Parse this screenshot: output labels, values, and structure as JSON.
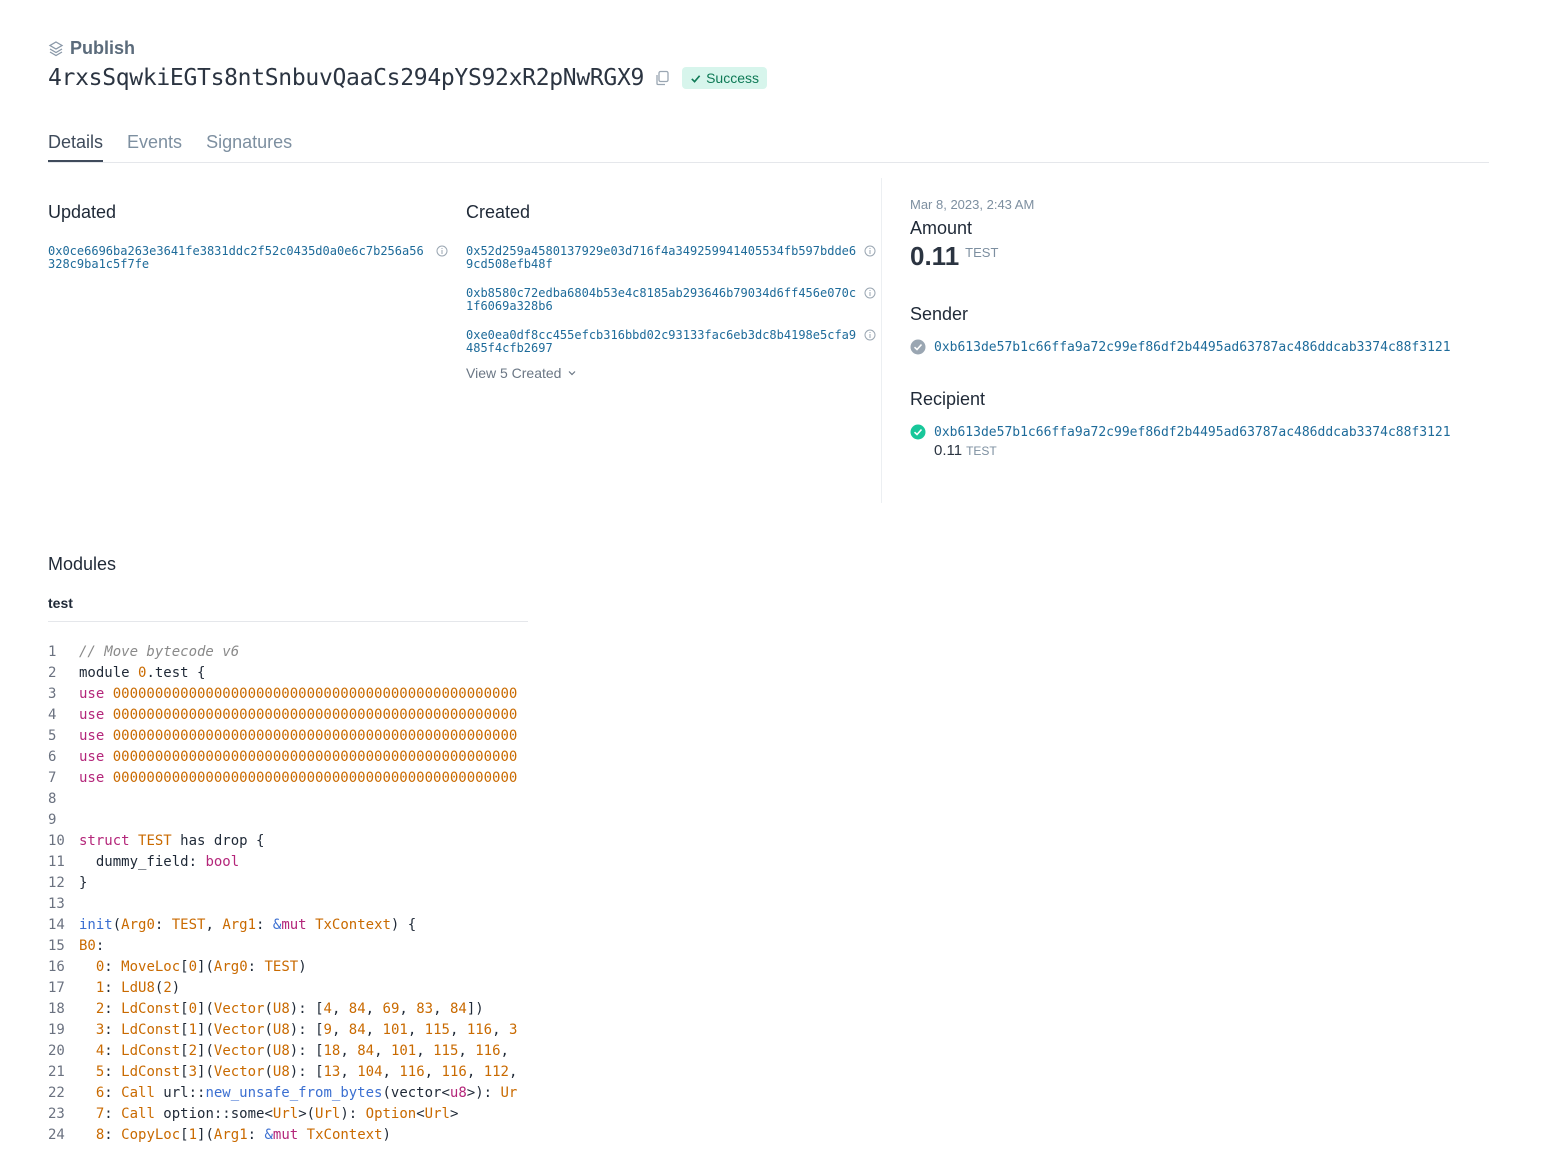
{
  "header": {
    "kind_label": "Publish",
    "digest": "4rxsSqwkiEGTs8ntSnbuvQaaCs294pYS92xR2pNwRGX9",
    "status": "Success"
  },
  "tabs": [
    {
      "label": "Details"
    },
    {
      "label": "Events"
    },
    {
      "label": "Signatures"
    }
  ],
  "updated": {
    "title": "Updated",
    "objects": [
      "0x0ce6696ba263e3641fe3831ddc2f52c0435d0a0e6c7b256a56328c9ba1c5f7fe"
    ]
  },
  "created": {
    "title": "Created",
    "objects": [
      "0x52d259a4580137929e03d716f4a349259941405534fb597bdde69cd508efb48f",
      "0xb8580c72edba6804b53e4c8185ab293646b79034d6ff456e070c1f6069a328b6",
      "0xe0ea0df8cc455efcb316bbd02c93133fac6eb3dc8b4198e5cfa9485f4cfb2697"
    ],
    "view_more": "View 5 Created"
  },
  "summary": {
    "timestamp": "Mar 8, 2023, 2:43 AM",
    "amount_label": "Amount",
    "amount_value": "0.11",
    "amount_unit": "TEST",
    "sender_label": "Sender",
    "sender_address": "0xb613de57b1c66ffa9a72c99ef86df2b4495ad63787ac486ddcab3374c88f3121",
    "recipient_label": "Recipient",
    "recipient_address": "0xb613de57b1c66ffa9a72c99ef86df2b4495ad63787ac486ddcab3374c88f3121",
    "recipient_amount": "0.11",
    "recipient_unit": "TEST"
  },
  "modules": {
    "title": "Modules",
    "module_name": "test",
    "code_lines": [
      "1",
      "2",
      "3",
      "4",
      "5",
      "6",
      "7",
      "8",
      "9",
      "10",
      "11",
      "12",
      "13",
      "14",
      "15",
      "16",
      "17",
      "18",
      "19",
      "20",
      "21",
      "22",
      "23",
      "24"
    ],
    "colors": {
      "keyword": "#b4267a",
      "number": "#c96a00",
      "function": "#3b6fd1"
    }
  }
}
